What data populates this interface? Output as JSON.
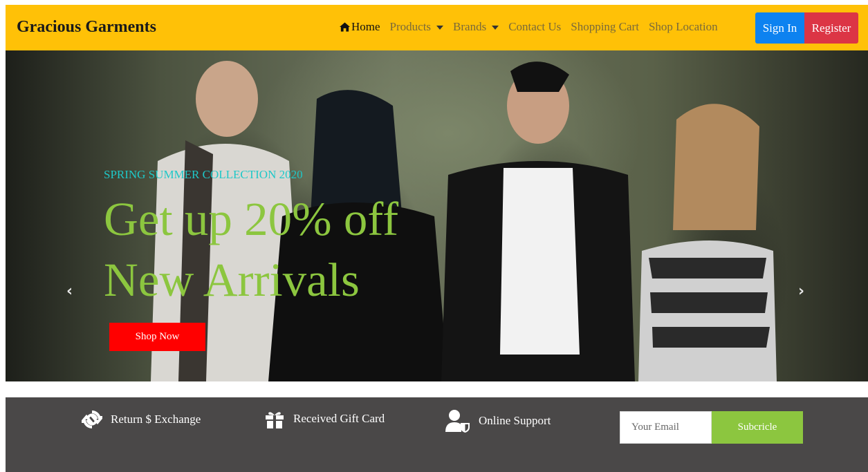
{
  "brand": "Gracious Garments",
  "nav": {
    "home": "Home",
    "products": "Products",
    "brands": "Brands",
    "contact": "Contact Us",
    "cart": "Shopping Cart",
    "location": "Shop Location",
    "signin": "Sign In",
    "register": "Register"
  },
  "hero": {
    "subtitle": "SPRING SUMMER COLLECTION 2020",
    "headline_line1": "Get up 20% off",
    "headline_line2": "New Arrivals",
    "button": "Shop Now",
    "prev_icon": "‹",
    "next_icon": "›"
  },
  "features": {
    "return": "Return $ Exchange",
    "gift": "Received Gift Card",
    "support": "Online Support"
  },
  "newsletter": {
    "placeholder": "Your Email",
    "button": "Subcricle"
  },
  "colors": {
    "navbar": "#FFC107",
    "signin": "#0d82f0",
    "register": "#DC3545",
    "headline": "#8cc63f",
    "subtitle": "#1ec8c8",
    "shop_button": "#FF0000",
    "features_bg": "#4a4848",
    "subscribe": "#8cc63f"
  }
}
